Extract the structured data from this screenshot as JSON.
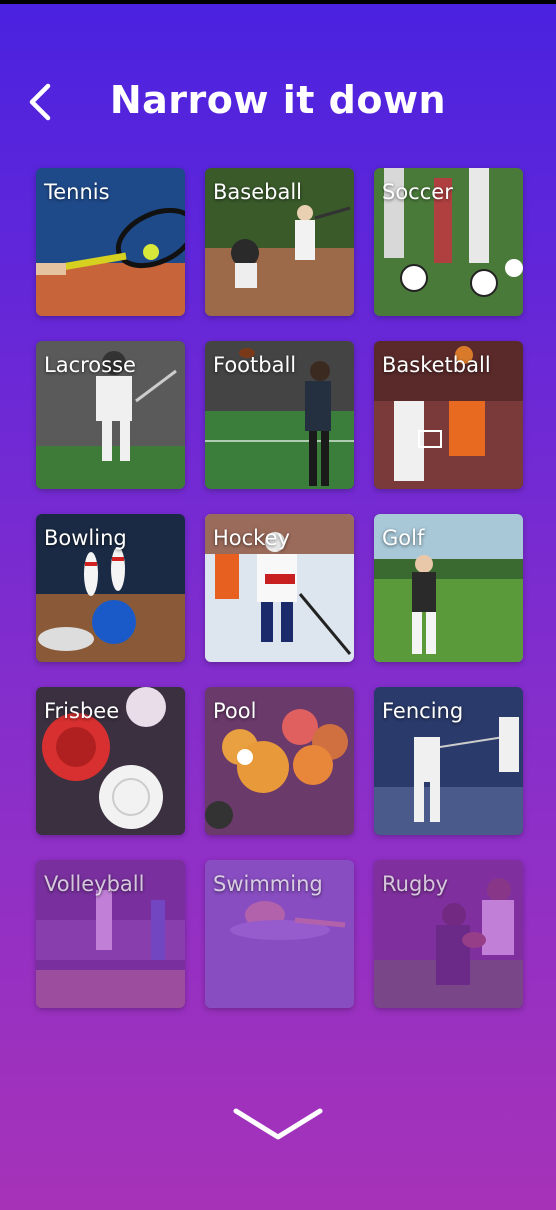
{
  "header": {
    "title": "Narrow it down",
    "back_icon": "chevron-left-icon"
  },
  "sports": [
    {
      "label": "Tennis",
      "faded": false
    },
    {
      "label": "Baseball",
      "faded": false
    },
    {
      "label": "Soccer",
      "faded": false
    },
    {
      "label": "Lacrosse",
      "faded": false
    },
    {
      "label": "Football",
      "faded": false
    },
    {
      "label": "Basketball",
      "faded": false
    },
    {
      "label": "Bowling",
      "faded": false
    },
    {
      "label": "Hockey",
      "faded": false
    },
    {
      "label": "Golf",
      "faded": false
    },
    {
      "label": "Frisbee",
      "faded": false
    },
    {
      "label": "Pool",
      "faded": false
    },
    {
      "label": "Fencing",
      "faded": false
    },
    {
      "label": "Volleyball",
      "faded": true
    },
    {
      "label": "Swimming",
      "faded": true
    },
    {
      "label": "Rugby",
      "faded": true
    }
  ],
  "footer": {
    "more_icon": "chevron-down-icon"
  },
  "colors": {
    "bg_top": "#4a22e0",
    "bg_bottom": "#a632b8"
  }
}
